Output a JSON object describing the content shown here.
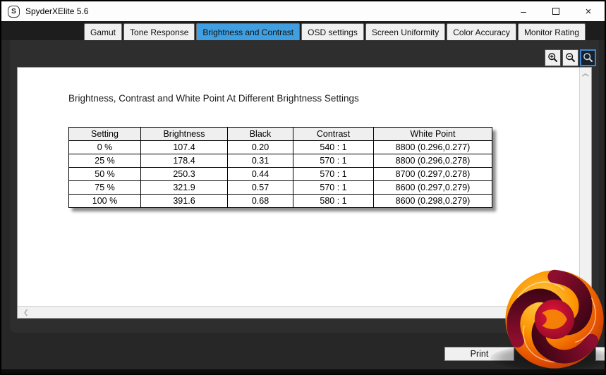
{
  "window": {
    "title": "SpyderXElite 5.6",
    "app_icon_letter": "S",
    "controls": {
      "minimize": "–",
      "close": "×"
    }
  },
  "tabs": [
    {
      "label": "Gamut",
      "selected": false
    },
    {
      "label": "Tone Response",
      "selected": false
    },
    {
      "label": "Brightness and Contrast",
      "selected": true
    },
    {
      "label": "OSD settings",
      "selected": false
    },
    {
      "label": "Screen Uniformity",
      "selected": false
    },
    {
      "label": "Color Accuracy",
      "selected": false
    },
    {
      "label": "Monitor Rating",
      "selected": false
    }
  ],
  "toolbar": {
    "icons": [
      "magnifier-plus",
      "magnifier-minus",
      "magnifier"
    ],
    "selected_index": 2
  },
  "report": {
    "title": "Brightness, Contrast and White Point At Different Brightness Settings",
    "table": {
      "headers": [
        "Setting",
        "Brightness",
        "Black",
        "Contrast",
        "White Point"
      ],
      "rows": [
        [
          "0 %",
          "107.4",
          "0.20",
          "540 : 1",
          "8800 (0.296,0.277)"
        ],
        [
          "25 %",
          "178.4",
          "0.31",
          "570 : 1",
          "8800 (0.296,0.278)"
        ],
        [
          "50 %",
          "250.3",
          "0.44",
          "570 : 1",
          "8700 (0.297,0.278)"
        ],
        [
          "75 %",
          "321.9",
          "0.57",
          "570 : 1",
          "8600 (0.297,0.279)"
        ],
        [
          "100 %",
          "391.6",
          "0.68",
          "580 : 1",
          "8600 (0.298,0.279)"
        ]
      ]
    }
  },
  "scrollbars": {
    "up_chevron": "❮",
    "left_chevron": "❮"
  },
  "footer": {
    "print_label": "Print"
  },
  "colors": {
    "selected_tab": "#3f9fe0",
    "titlebar_bg": "#fdfdfd",
    "frame_bg": "#2e2e2e",
    "tabstrip_bg": "#1d1d1d",
    "zoom_selected_border": "#3a86d4",
    "logo_orange": "#f57c00",
    "logo_maroon": "#5c0a1e",
    "logo_red": "#c8102e"
  }
}
